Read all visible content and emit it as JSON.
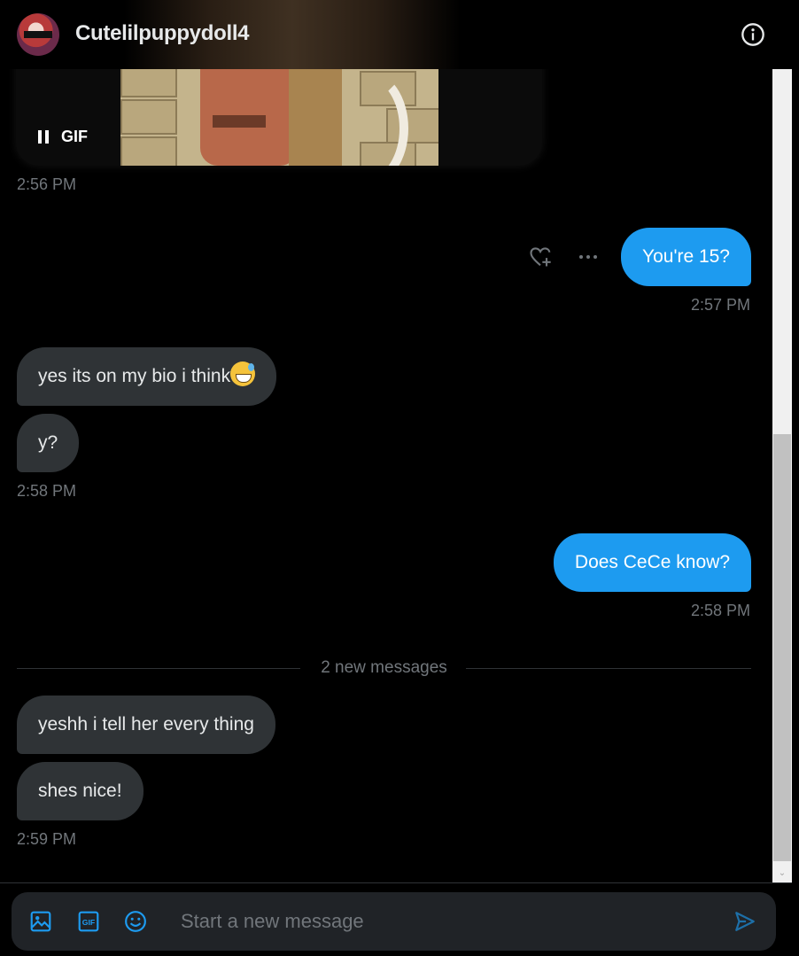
{
  "header": {
    "title": "Cutelilpuppydoll4"
  },
  "gif": {
    "label": "GIF",
    "time": "2:56 PM"
  },
  "messages": [
    {
      "from": "me",
      "text": "You're 15?",
      "time": "2:57 PM"
    },
    {
      "from": "them",
      "text": "yes its on my bio i think"
    },
    {
      "from": "them",
      "text": "y?",
      "time": "2:58 PM"
    },
    {
      "from": "me",
      "text": "Does CeCe know?",
      "time": "2:58 PM"
    },
    {
      "from": "them",
      "text": "yeshh i tell her every thing"
    },
    {
      "from": "them",
      "text": "shes nice!",
      "time": "2:59 PM"
    }
  ],
  "divider": {
    "text": "2 new messages"
  },
  "composer": {
    "placeholder": "Start a new message"
  },
  "colors": {
    "accent": "#1d9bf0",
    "bubble_them": "#2f3336",
    "muted": "#71767b"
  },
  "icons": [
    "info-icon",
    "pause-icon",
    "add-reaction-icon",
    "more-icon",
    "image-icon",
    "gif-icon",
    "emoji-icon",
    "send-icon"
  ]
}
